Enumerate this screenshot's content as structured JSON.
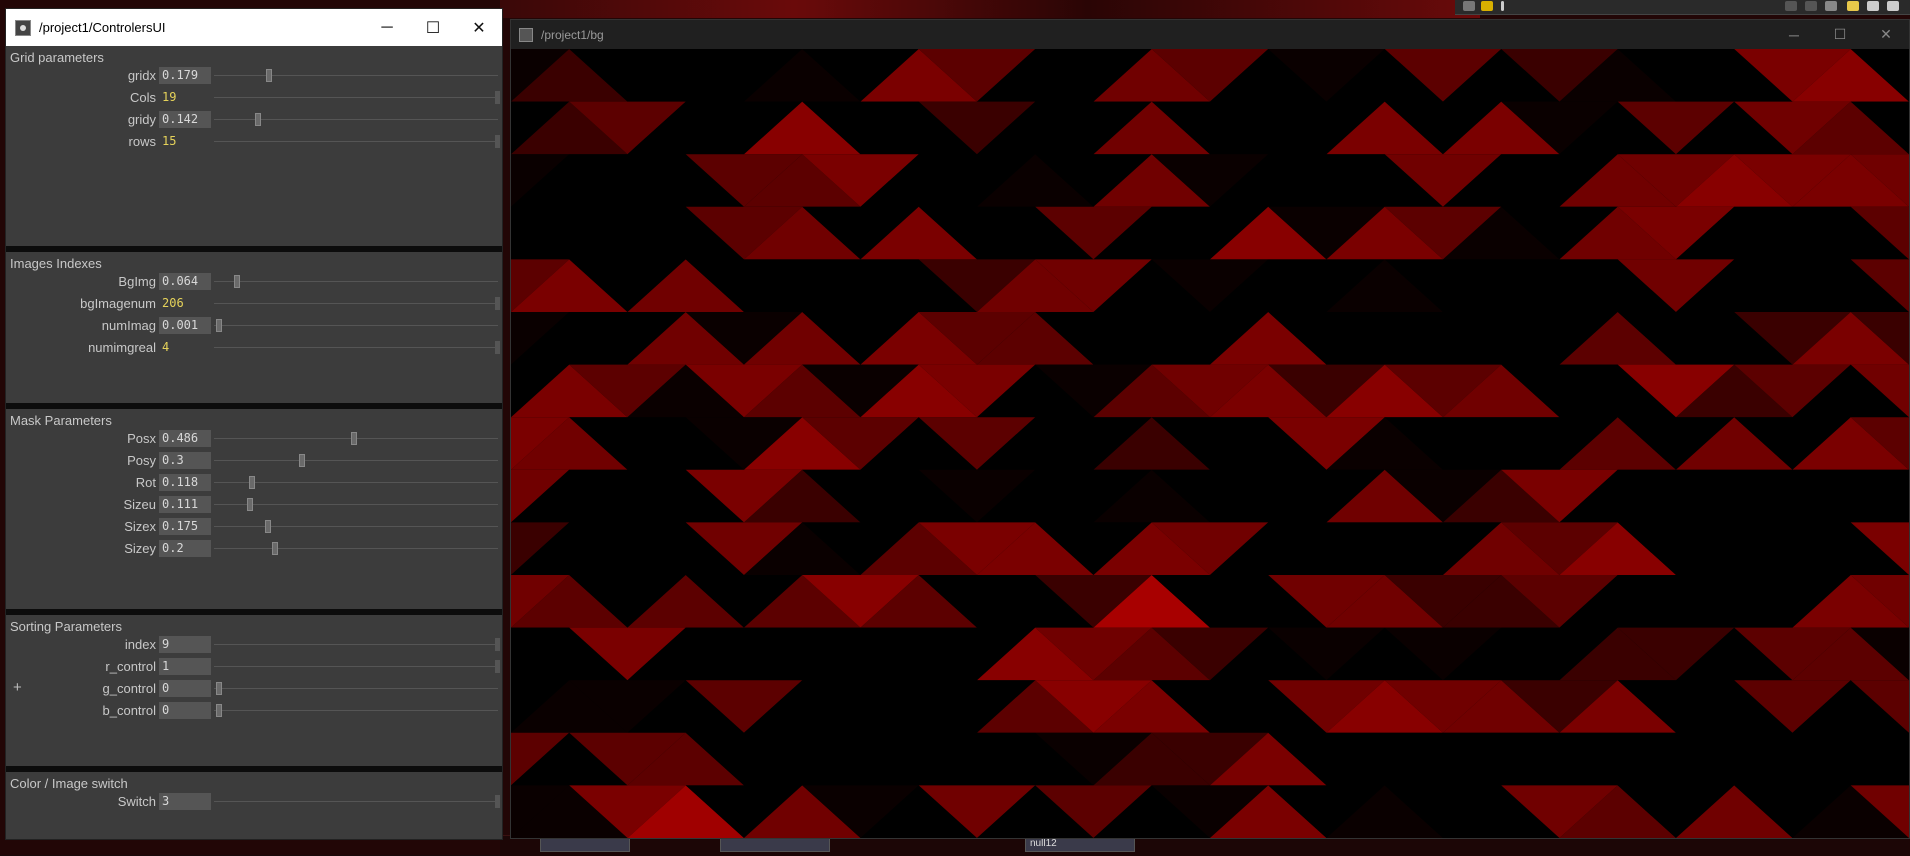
{
  "controllers_window": {
    "title": "/project1/ControlersUI",
    "controls": {
      "minimize": "─",
      "maximize": "☐",
      "close": "✕"
    },
    "sections": [
      {
        "title": "Grid parameters",
        "params": [
          {
            "label": "gridx",
            "value": "0.179",
            "kind": "float",
            "level": 0.179
          },
          {
            "label": "Cols",
            "value": "19",
            "kind": "int",
            "level": 1.0
          },
          {
            "label": "gridy",
            "value": "0.142",
            "kind": "float",
            "level": 0.142
          },
          {
            "label": "rows",
            "value": "15",
            "kind": "int",
            "level": 1.0
          }
        ]
      },
      {
        "title": "Images Indexes",
        "params": [
          {
            "label": "BgImg",
            "value": "0.064",
            "kind": "float",
            "level": 0.064
          },
          {
            "label": "bgImagenum",
            "value": "206",
            "kind": "int",
            "level": 1.0
          },
          {
            "label": "numImag",
            "value": "0.001",
            "kind": "float",
            "level": 0.001
          },
          {
            "label": "numimgreal",
            "value": "4",
            "kind": "int",
            "level": 1.0
          }
        ]
      },
      {
        "title": "Mask Parameters",
        "params": [
          {
            "label": "Posx",
            "value": "0.486",
            "kind": "float",
            "level": 0.486
          },
          {
            "label": "Posy",
            "value": "0.3",
            "kind": "float",
            "level": 0.3
          },
          {
            "label": "Rot",
            "value": "0.118",
            "kind": "float",
            "level": 0.118
          },
          {
            "label": "Sizeu",
            "value": "0.111",
            "kind": "float",
            "level": 0.111
          },
          {
            "label": "Sizex",
            "value": "0.175",
            "kind": "float",
            "level": 0.175
          },
          {
            "label": "Sizey",
            "value": "0.2",
            "kind": "float",
            "level": 0.2
          }
        ]
      },
      {
        "title": "Sorting Parameters",
        "params": [
          {
            "label": "index",
            "value": "9",
            "kind": "float",
            "level": 1.0
          },
          {
            "label": "r_control",
            "value": "1",
            "kind": "float",
            "level": 1.0
          },
          {
            "label": "g_control",
            "value": "0",
            "kind": "float",
            "level": 0.0
          },
          {
            "label": "b_control",
            "value": "0",
            "kind": "float",
            "level": 0.0
          }
        ]
      },
      {
        "title": "Color / Image switch",
        "params": [
          {
            "label": "Switch",
            "value": "3",
            "kind": "float",
            "level": 1.0
          }
        ]
      }
    ],
    "plus_symbol": "+"
  },
  "bg_window": {
    "title": "/project1/bg",
    "controls": {
      "minimize": "─",
      "maximize": "☐",
      "close": "✕"
    }
  },
  "backdrop": {
    "node_label": "null12"
  },
  "colors": {
    "panel_bg": "#3c3c3c",
    "int_value": "#e6d35a",
    "red_dark": "#5a0000",
    "red_mid": "#7a0000",
    "red_bright": "#a80000"
  }
}
